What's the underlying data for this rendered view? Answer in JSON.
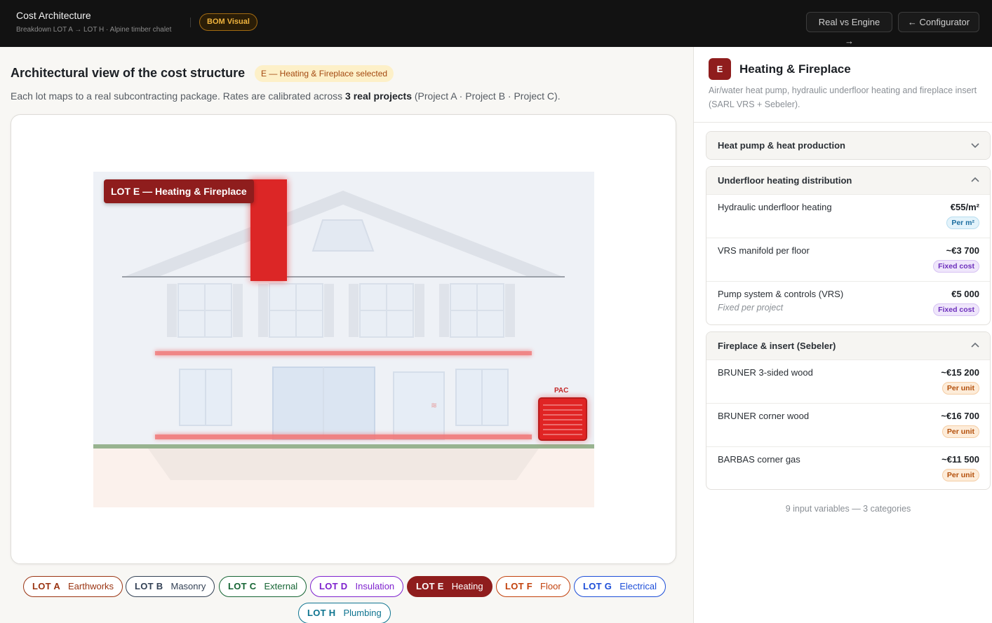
{
  "header": {
    "title": "Cost Architecture",
    "subtitle": "Breakdown LOT A → LOT H · Alpine timber chalet",
    "badge": "BOM Visual",
    "btn_real_vs_engine": "Real vs Engine →",
    "btn_configurator": "← Configurator"
  },
  "main": {
    "heading": "Architectural view of the cost structure",
    "selected_badge": "E — Heating & Fireplace selected",
    "desc_before": "Each lot maps to a real subcontracting package. Rates are calibrated across ",
    "desc_bold": "3 real projects",
    "desc_after": " (Project A · Project B · Project C).",
    "canvas": {
      "lot_label": "LOT E — Heating & Fireplace",
      "pac_label": "PAC",
      "heat_glyph": "≋"
    }
  },
  "lots": [
    {
      "code": "LOT A",
      "name": "Earthworks",
      "color": "#9a3412",
      "selected": false
    },
    {
      "code": "LOT B",
      "name": "Masonry",
      "color": "#334155",
      "selected": false
    },
    {
      "code": "LOT C",
      "name": "External",
      "color": "#166534",
      "selected": false
    },
    {
      "code": "LOT D",
      "name": "Insulation",
      "color": "#7e22ce",
      "selected": false
    },
    {
      "code": "LOT E",
      "name": "Heating",
      "color": "#8f1d1d",
      "selected": true
    },
    {
      "code": "LOT F",
      "name": "Floor",
      "color": "#c2410c",
      "selected": false
    },
    {
      "code": "LOT G",
      "name": "Electrical",
      "color": "#1d4ed8",
      "selected": false
    },
    {
      "code": "LOT H",
      "name": "Plumbing",
      "color": "#0e7490",
      "selected": false
    }
  ],
  "panel": {
    "badge": "E",
    "title": "Heating & Fireplace",
    "description": "Air/water heat pump, hydraulic underfloor heating and fireplace insert (SARL VRS + Sebeler).",
    "sections": [
      {
        "title": "Heat pump & heat production",
        "expanded": false,
        "items": []
      },
      {
        "title": "Underfloor heating distribution",
        "expanded": true,
        "items": [
          {
            "name": "Hydraulic underfloor heating",
            "note": "",
            "price": "€55/m²",
            "tag": "Per m²",
            "tag_type": "m2"
          },
          {
            "name": "VRS manifold per floor",
            "note": "",
            "price": "~€3 700",
            "tag": "Fixed cost",
            "tag_type": "fixed"
          },
          {
            "name": "Pump system & controls (VRS)",
            "note": "Fixed per project",
            "price": "€5 000",
            "tag": "Fixed cost",
            "tag_type": "fixed"
          }
        ]
      },
      {
        "title": "Fireplace & insert (Sebeler)",
        "expanded": true,
        "items": [
          {
            "name": "BRUNER 3-sided wood",
            "note": "",
            "price": "~€15 200",
            "tag": "Per unit",
            "tag_type": "unit"
          },
          {
            "name": "BRUNER corner wood",
            "note": "",
            "price": "~€16 700",
            "tag": "Per unit",
            "tag_type": "unit"
          },
          {
            "name": "BARBAS corner gas",
            "note": "",
            "price": "~€11 500",
            "tag": "Per unit",
            "tag_type": "unit"
          }
        ]
      }
    ],
    "footer": "9 input variables — 3 categories"
  }
}
